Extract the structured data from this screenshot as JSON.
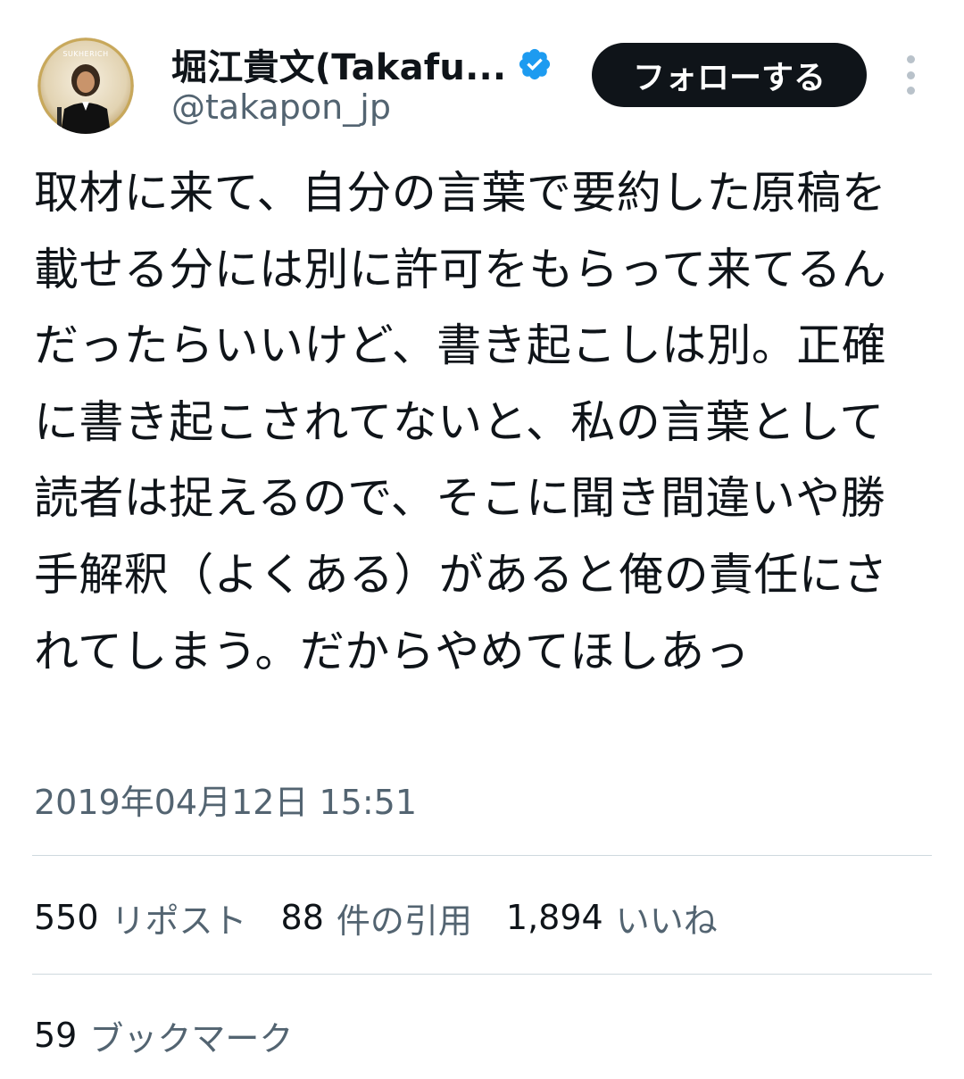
{
  "user": {
    "display_name": "堀江貴文(Takafu...",
    "handle": "@takapon_jp",
    "verified": true,
    "avatar_label": "SUKHERICH"
  },
  "actions": {
    "follow_label": "フォローする",
    "more_icon": "more-vertical-icon"
  },
  "tweet": {
    "text": "取材に来て、自分の言葉で要約した原稿を載せる分には別に許可をもらって来てるんだったらいいけど、書き起こしは別。正確に書き起こされてないと、私の言葉として読者は捉えるので、そこに聞き間違いや勝手解釈（よくある）があると俺の責任にされてしまう。だからやめてほしあっ",
    "timestamp": "2019年04月12日 15:51"
  },
  "stats": {
    "reposts": {
      "count": "550",
      "label": "リポスト"
    },
    "quotes": {
      "count": "88",
      "label": "件の引用"
    },
    "likes": {
      "count": "1,894",
      "label": "いいね"
    },
    "bookmarks": {
      "count": "59",
      "label": "ブックマーク"
    }
  },
  "colors": {
    "text": "#0f1419",
    "secondary": "#536471",
    "verified": "#1d9bf0",
    "divider": "#cfd9de"
  }
}
